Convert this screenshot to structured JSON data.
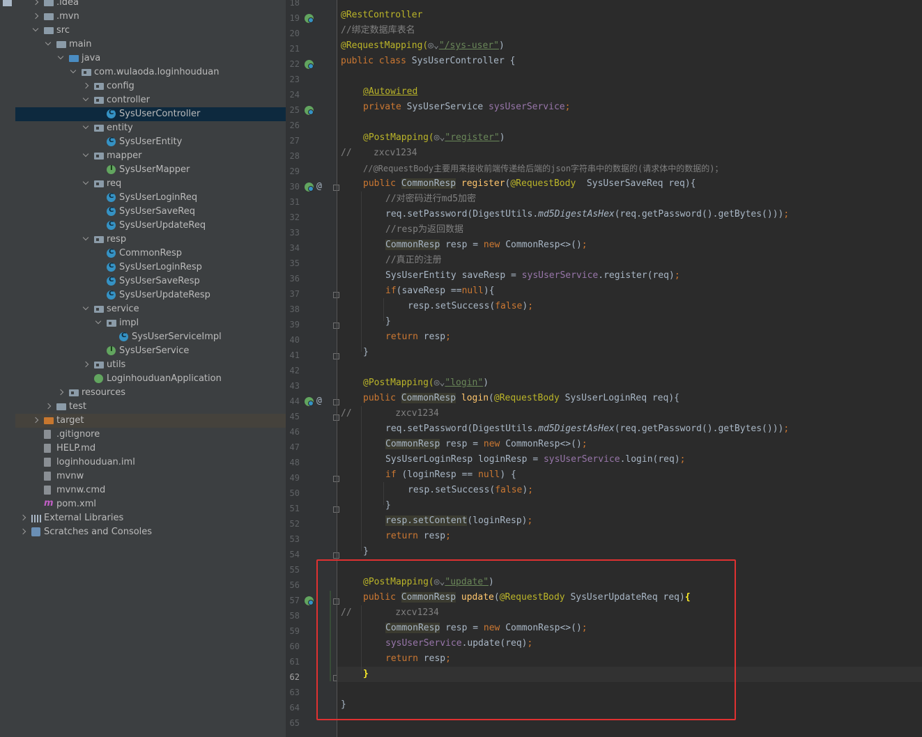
{
  "project_tree": [
    {
      "label": ".idea",
      "depth": 1,
      "arrow": "closed",
      "icon": "folder-icon"
    },
    {
      "label": ".mvn",
      "depth": 1,
      "arrow": "closed",
      "icon": "folder-icon"
    },
    {
      "label": "src",
      "depth": 1,
      "arrow": "open",
      "icon": "folder-icon"
    },
    {
      "label": "main",
      "depth": 2,
      "arrow": "open",
      "icon": "folder-icon"
    },
    {
      "label": "java",
      "depth": 3,
      "arrow": "open",
      "icon": "source-folder-icon"
    },
    {
      "label": "com.wulaoda.loginhouduan",
      "depth": 4,
      "arrow": "open",
      "icon": "package-icon"
    },
    {
      "label": "config",
      "depth": 5,
      "arrow": "closed",
      "icon": "package-icon"
    },
    {
      "label": "controller",
      "depth": 5,
      "arrow": "open",
      "icon": "package-icon"
    },
    {
      "label": "SysUserController",
      "depth": 6,
      "arrow": "",
      "icon": "class-icon",
      "selected": true
    },
    {
      "label": "entity",
      "depth": 5,
      "arrow": "open",
      "icon": "package-icon"
    },
    {
      "label": "SysUserEntity",
      "depth": 6,
      "arrow": "",
      "icon": "class-icon"
    },
    {
      "label": "mapper",
      "depth": 5,
      "arrow": "open",
      "icon": "package-icon"
    },
    {
      "label": "SysUserMapper",
      "depth": 6,
      "arrow": "",
      "icon": "interface-icon"
    },
    {
      "label": "req",
      "depth": 5,
      "arrow": "open",
      "icon": "package-icon"
    },
    {
      "label": "SysUserLoginReq",
      "depth": 6,
      "arrow": "",
      "icon": "class-icon"
    },
    {
      "label": "SysUserSaveReq",
      "depth": 6,
      "arrow": "",
      "icon": "class-icon"
    },
    {
      "label": "SysUserUpdateReq",
      "depth": 6,
      "arrow": "",
      "icon": "class-icon"
    },
    {
      "label": "resp",
      "depth": 5,
      "arrow": "open",
      "icon": "package-icon"
    },
    {
      "label": "CommonResp",
      "depth": 6,
      "arrow": "",
      "icon": "class-icon"
    },
    {
      "label": "SysUserLoginResp",
      "depth": 6,
      "arrow": "",
      "icon": "class-icon"
    },
    {
      "label": "SysUserSaveResp",
      "depth": 6,
      "arrow": "",
      "icon": "class-icon"
    },
    {
      "label": "SysUserUpdateResp",
      "depth": 6,
      "arrow": "",
      "icon": "class-icon"
    },
    {
      "label": "service",
      "depth": 5,
      "arrow": "open",
      "icon": "package-icon"
    },
    {
      "label": "impl",
      "depth": 6,
      "arrow": "open",
      "icon": "package-icon"
    },
    {
      "label": "SysUserServiceImpl",
      "depth": 7,
      "arrow": "",
      "icon": "class-icon"
    },
    {
      "label": "SysUserService",
      "depth": 6,
      "arrow": "",
      "icon": "interface-icon"
    },
    {
      "label": "utils",
      "depth": 5,
      "arrow": "closed",
      "icon": "package-icon"
    },
    {
      "label": "LoginhouduanApplication",
      "depth": 5,
      "arrow": "",
      "icon": "spring-boot-app-icon"
    },
    {
      "label": "resources",
      "depth": 3,
      "arrow": "closed",
      "icon": "resources-folder-icon"
    },
    {
      "label": "test",
      "depth": 2,
      "arrow": "closed",
      "icon": "folder-icon"
    },
    {
      "label": "target",
      "depth": 1,
      "arrow": "closed",
      "icon": "excluded-folder-icon",
      "highlighted": true
    },
    {
      "label": ".gitignore",
      "depth": 1,
      "arrow": "",
      "icon": "file-icon"
    },
    {
      "label": "HELP.md",
      "depth": 1,
      "arrow": "",
      "icon": "markdown-file-icon"
    },
    {
      "label": "loginhouduan.iml",
      "depth": 1,
      "arrow": "",
      "icon": "file-icon"
    },
    {
      "label": "mvnw",
      "depth": 1,
      "arrow": "",
      "icon": "script-file-icon"
    },
    {
      "label": "mvnw.cmd",
      "depth": 1,
      "arrow": "",
      "icon": "file-icon"
    },
    {
      "label": "pom.xml",
      "depth": 1,
      "arrow": "",
      "icon": "maven-icon"
    },
    {
      "label": "External Libraries",
      "depth": 0,
      "arrow": "closed",
      "icon": "libraries-icon"
    },
    {
      "label": "Scratches and Consoles",
      "depth": 0,
      "arrow": "closed",
      "icon": "scratches-icon"
    }
  ],
  "editor": {
    "first_line": 19,
    "current_line": 62,
    "line_numbers": [
      "18",
      "19",
      "20",
      "21",
      "22",
      "23",
      "24",
      "25",
      "26",
      "27",
      "28",
      "29",
      "30",
      "31",
      "32",
      "33",
      "34",
      "35",
      "36",
      "37",
      "38",
      "39",
      "40",
      "41",
      "42",
      "43",
      "44",
      "45",
      "46",
      "47",
      "48",
      "49",
      "50",
      "51",
      "52",
      "53",
      "54",
      "55",
      "56",
      "57",
      "58",
      "59",
      "60",
      "61",
      "62",
      "63",
      "64",
      "65"
    ],
    "code": {
      "restcontroller": "@RestController",
      "comment_table": "//绑定数据库表名",
      "requestmapping": "@RequestMapping(",
      "requestmapping_path": "\"/sys-user\"",
      "class_decl_kw": "public class ",
      "class_decl_rest": "SysUserController {",
      "autowired": "@Autowired",
      "private_kw": "private ",
      "service_type": "SysUserService ",
      "service_field": "sysUserService",
      "postmapping": "@PostMapping(",
      "path_register": "\"register\"",
      "commented_zxcv_28": "//    zxcv1234",
      "comment_requestbody": "//@RequestBody主要用来接收前端传递给后端的json字符串中的数据的(请求体中的数据的)；",
      "public_kw": "public ",
      "common_resp": "CommonResp",
      "register_name": "register",
      "requestbody": "@RequestBody",
      "register_params": "  SysUserSaveReq req){",
      "comment_pwd": "//对密码进行md5加密",
      "set_password_a": "req.setPassword(DigestUtils.",
      "md5_method": "md5DigestAsHex",
      "set_password_b": "(req.getPassword().getBytes()))",
      "comment_resp": "//resp为返回数据",
      "resp_var": " resp = ",
      "new_kw": "new ",
      "new_commonresp": "CommonResp<>()",
      "comment_register": "//真正的注册",
      "save_entity": "SysUserEntity saveResp = ",
      "register_call": ".register(req)",
      "if_kw": "if",
      "if_save_cond": "(saveResp ==",
      "null_kw": "null",
      "if_save_end": "){",
      "set_success": "resp.setSuccess(",
      "false_kw": "false",
      "close_paren": ")",
      "close_brace": "}",
      "return_kw": "return ",
      "return_resp": "resp",
      "semicolon": ";",
      "path_login": "\"login\"",
      "login_name": "login",
      "login_params": " SysUserLoginReq req){",
      "commented_zxcv_45": "//        zxcv1234",
      "login_resp_decl": "SysUserLoginResp loginResp = ",
      "login_call": ".login(req)",
      "if_login_cond": " (loginResp == ",
      "if_login_end": ") {",
      "set_content": "resp.setContent",
      "set_content_args": "(loginResp)",
      "path_update": "\"update\"",
      "update_name": "update",
      "update_params": " SysUserUpdateReq req)",
      "open_brace": "{",
      "commented_zxcv_58": "//        zxcv1234",
      "update_call": ".update(req)",
      "class_close": "}",
      "open_paren": "(",
      "paren_close_line": ")"
    }
  },
  "colors": {
    "keyword": "#cc7832",
    "annotation": "#bbb529",
    "string": "#6a8759",
    "comment": "#808080",
    "method": "#ffc66d",
    "field": "#9876aa",
    "highlight_box": "#e03131"
  }
}
